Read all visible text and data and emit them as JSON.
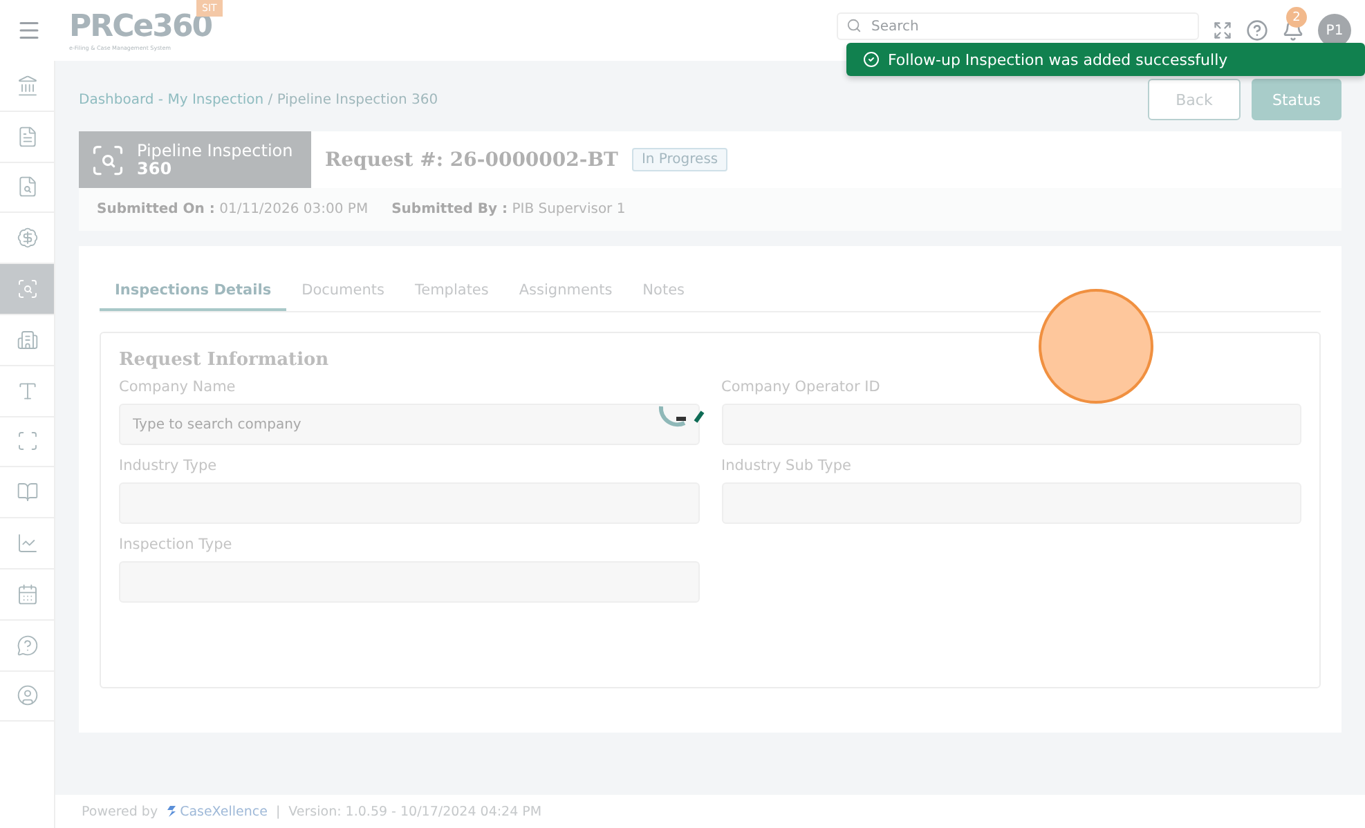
{
  "header": {
    "logo": "PRCe360",
    "logo_subtitle": "e-Filing & Case Management System",
    "env_badge": "SIT",
    "search": {
      "placeholder": "Search"
    },
    "notification_count": "2",
    "avatar": "P1"
  },
  "toast": {
    "message": "Follow-up Inspection was added successfully"
  },
  "sidebar": {
    "items": [
      {
        "selected": false
      },
      {
        "selected": false
      },
      {
        "selected": false
      },
      {
        "selected": false
      },
      {
        "selected": true
      },
      {
        "selected": false
      },
      {
        "selected": false
      },
      {
        "selected": false
      },
      {
        "selected": false
      },
      {
        "selected": false
      },
      {
        "selected": false
      },
      {
        "selected": false
      },
      {
        "selected": false
      }
    ]
  },
  "breadcrumb": {
    "parent": "Dashboard - My Inspection",
    "separator": "/",
    "current": "Pipeline Inspection 360"
  },
  "actions": [
    "Back",
    "Status"
  ],
  "request": {
    "module_line1": "Pipeline Inspection",
    "module_line2": "360",
    "request_label": "Request #: 26-0000002-BT",
    "status": "In Progress",
    "submitted_on_label": "Submitted On :",
    "submitted_on": "01/11/2026 03:00 PM",
    "submitted_by_label": "Submitted By :",
    "submitted_by": "PIB Supervisor 1"
  },
  "tabs": [
    {
      "label": "Inspections Details",
      "selected": true
    },
    {
      "label": "Documents",
      "selected": false
    },
    {
      "label": "Templates",
      "selected": false
    },
    {
      "label": "Assignments",
      "selected": false
    },
    {
      "label": "Notes",
      "selected": false
    }
  ],
  "section": {
    "title": "Request Information",
    "fields": [
      {
        "label": "Company Name",
        "placeholder": "Type to search company"
      },
      {
        "label": "Company Operator ID"
      },
      {
        "label": "Industry Type"
      },
      {
        "label": "Industry Sub Type"
      },
      {
        "label": "Inspection Type"
      }
    ]
  },
  "footer": {
    "powered_by": "Powered by",
    "brand": "CaseXellence",
    "separator": "|",
    "version": "Version: 1.0.59 - 10/17/2024 04:24 PM"
  }
}
